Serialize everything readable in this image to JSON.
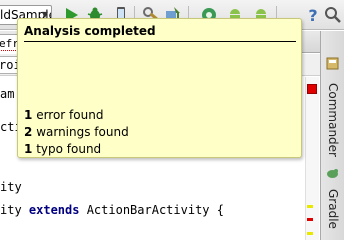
{
  "toolbar": {
    "module_selector_value": "ldSample",
    "icons": [
      "run-icon",
      "debug-icon",
      "device-icon",
      "build-icon",
      "sdk-manager-icon",
      "avd-manager-icon",
      "android-icon",
      "android-monitor-icon",
      "help-icon",
      "search-icon"
    ]
  },
  "editor": {
    "tab_label": "efre",
    "breadcrumb_label": "roid",
    "code_lines": [
      {
        "text": "am"
      },
      {
        "text": "cti"
      },
      {
        "text": "ity"
      },
      {
        "text_before": "ity ",
        "keyword": "extends",
        "text_after": " ActionBarActivity {"
      }
    ]
  },
  "side_panel": {
    "items": [
      "Commander",
      "Gradle"
    ]
  },
  "balloon": {
    "title": "Analysis completed",
    "rows": [
      {
        "count": "1",
        "label": "error found"
      },
      {
        "count": "2",
        "label": "warnings found"
      },
      {
        "count": "1",
        "label": "typo found"
      }
    ]
  },
  "colors": {
    "balloon_bg": "#ffffc8",
    "error": "#e00000",
    "warning": "#e8e800",
    "keyword": "#000080"
  }
}
